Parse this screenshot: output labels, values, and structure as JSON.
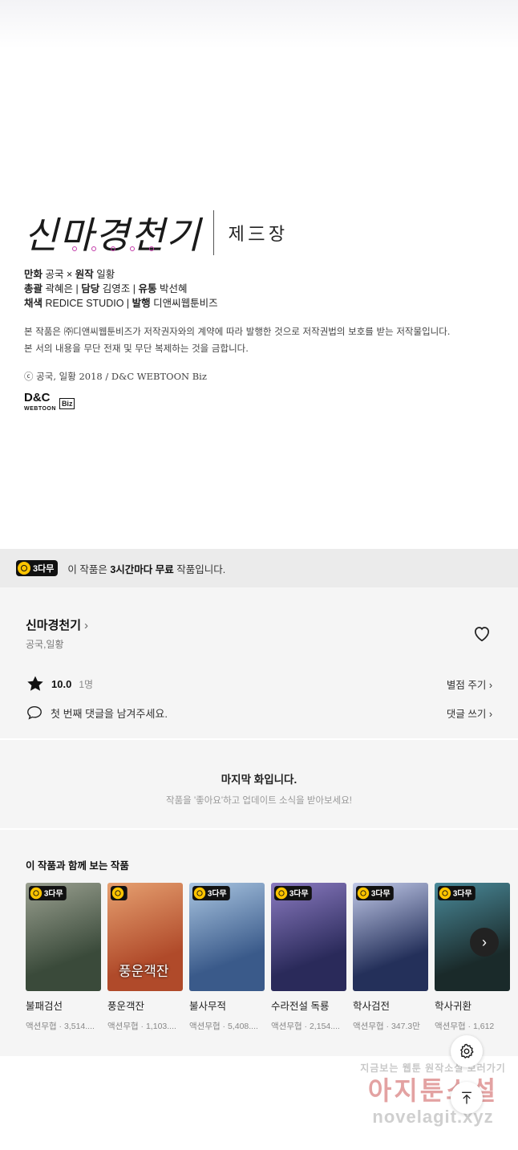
{
  "credit": {
    "logo_title": "신마경천기",
    "logo_subtitle": "제三장",
    "staff_line1": {
      "l1": "만화",
      "v1": "공국",
      "sep": " × ",
      "l2": "원작",
      "v2": "일황"
    },
    "staff_line2": {
      "l1": "총괄",
      "v1": "곽혜은",
      "l2": "담당",
      "v2": "김영조",
      "l3": "유통",
      "v3": "박선혜"
    },
    "staff_line3": {
      "l1": "채색",
      "v1": "REDICE STUDIO",
      "l2": "발행",
      "v2": "디앤씨웹툰비즈"
    },
    "legal_1": "본 작품은 ㈜디앤씨웹툰비즈가 저작권자와의 계약에 따라 발행한 것으로 저작권법의 보호를 받는 저작물입니다.",
    "legal_2": "본 서의 내용을 무단 전재 및 무단 복제하는 것을 금합니다.",
    "copyright": "ⓒ 공국, 일황 2018 / D&C WEBTOON Biz",
    "publisher_logo": {
      "main": "D&C",
      "sub": "WEBTOON",
      "biz": "Biz"
    }
  },
  "free_banner": {
    "badge": "3다무",
    "prefix": "이 작품은 ",
    "bold": "3시간마다 무료",
    "suffix": " 작품입니다."
  },
  "work": {
    "title": "신마경천기",
    "chevron": "›",
    "authors": "공국,일황",
    "score": "10.0",
    "rating_count": "1명",
    "rate_link": "별점 주기 ›",
    "comment_prompt": "첫 번째 댓글을 남겨주세요.",
    "comment_link": "댓글 쓰기 ›"
  },
  "last_episode": {
    "title": "마지막 화입니다.",
    "subtitle": "작품을 '좋아요'하고 업데이트 소식을 받아보세요!"
  },
  "recommendations": {
    "heading": "이 작품과 함께 보는 작품",
    "items": [
      {
        "title": "불패검선",
        "meta": "액션무협 · 3,514....",
        "badge": "3다무",
        "cover_text": "",
        "colors": [
          "#3a4a3a",
          "#9aa090"
        ]
      },
      {
        "title": "풍운객잔",
        "meta": "액션무협 · 1,103....",
        "badge": "",
        "cover_text": "풍운객잔",
        "colors": [
          "#b04a2a",
          "#e6a070"
        ]
      },
      {
        "title": "불사무적",
        "meta": "액션무협 · 5,408....",
        "badge": "3다무",
        "cover_text": "",
        "colors": [
          "#3a5a8a",
          "#a8c4e0"
        ]
      },
      {
        "title": "수라전설 독룡",
        "meta": "액션무협 · 2,154....",
        "badge": "3다무",
        "cover_text": "",
        "colors": [
          "#2a2a5a",
          "#8a7ac0"
        ]
      },
      {
        "title": "학사검전",
        "meta": "액션무협 · 347.3만",
        "badge": "3다무",
        "cover_text": "",
        "colors": [
          "#24305a",
          "#c0c8e8"
        ]
      },
      {
        "title": "학사귀환",
        "meta": "액션무협 · 1,612",
        "badge": "3다무",
        "cover_text": "",
        "colors": [
          "#1a2a2a",
          "#4a8a9a"
        ]
      }
    ],
    "next": "›"
  },
  "watermark": {
    "line1": "지금보는 웹툰 원작소설 보러가기",
    "line2": "아지툰소설",
    "line3": "novelagit.xyz"
  }
}
